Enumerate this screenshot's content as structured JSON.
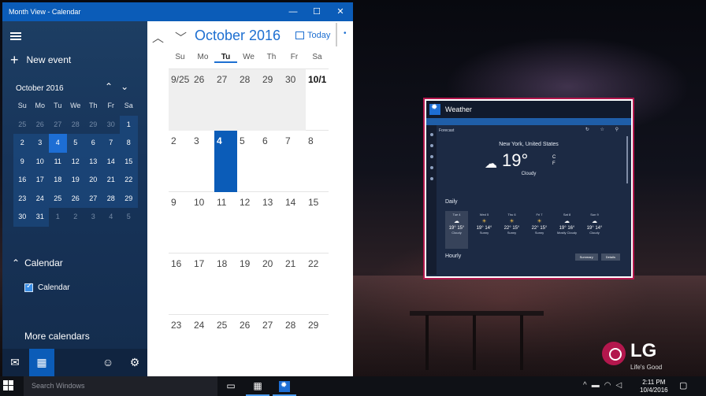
{
  "window": {
    "title": "Month View - Calendar",
    "min_glyph": "—",
    "max_glyph": "☐",
    "close_glyph": "✕"
  },
  "sidebar": {
    "new_event": "New event",
    "mini_month": "October 2016",
    "mini_up": "⌃",
    "mini_down": "⌄",
    "mini_dow": [
      "Su",
      "Mo",
      "Tu",
      "We",
      "Th",
      "Fr",
      "Sa"
    ],
    "mini_weeks": [
      [
        "25",
        "26",
        "27",
        "28",
        "29",
        "30",
        "1"
      ],
      [
        "2",
        "3",
        "4",
        "5",
        "6",
        "7",
        "8"
      ],
      [
        "9",
        "10",
        "11",
        "12",
        "13",
        "14",
        "15"
      ],
      [
        "16",
        "17",
        "18",
        "19",
        "20",
        "21",
        "22"
      ],
      [
        "23",
        "24",
        "25",
        "26",
        "27",
        "28",
        "29"
      ],
      [
        "30",
        "31",
        "1",
        "2",
        "3",
        "4",
        "5"
      ]
    ],
    "calendar_section": "Calendar",
    "calendar_item": "Calendar",
    "more_calendars": "More calendars"
  },
  "main": {
    "month_title": "October 2016",
    "today_label": "Today",
    "dow": [
      "Su",
      "Mo",
      "Tu",
      "We",
      "Th",
      "Fr",
      "Sa"
    ],
    "weeks": [
      [
        "9/25",
        "26",
        "27",
        "28",
        "29",
        "30",
        "10/1"
      ],
      [
        "2",
        "3",
        "4",
        "5",
        "6",
        "7",
        "8"
      ],
      [
        "9",
        "10",
        "11",
        "12",
        "13",
        "14",
        "15"
      ],
      [
        "16",
        "17",
        "18",
        "19",
        "20",
        "21",
        "22"
      ],
      [
        "23",
        "24",
        "25",
        "26",
        "27",
        "28",
        "29"
      ]
    ],
    "selected_day": "4"
  },
  "weather": {
    "title": "Weather",
    "header": "Forecast",
    "city": "New York, United States",
    "temp": "19°",
    "units": "C\nF",
    "condition": "Cloudy",
    "daily_label": "Daily",
    "days": [
      {
        "name": "Tue 4",
        "temp": "19° 15°",
        "cond": "Cloudy"
      },
      {
        "name": "Wed 5",
        "temp": "19° 14°",
        "cond": "Sunny"
      },
      {
        "name": "Thu 6",
        "temp": "22° 15°",
        "cond": "Sunny"
      },
      {
        "name": "Fri 7",
        "temp": "22° 15°",
        "cond": "Sunny"
      },
      {
        "name": "Sat 8",
        "temp": "19° 16°",
        "cond": "Mostly Cloudy"
      },
      {
        "name": "Sun 9",
        "temp": "19° 14°",
        "cond": "Cloudy"
      }
    ],
    "hourly_label": "Hourly",
    "summary_btn": "Summary",
    "details_btn": "Details"
  },
  "taskbar": {
    "search_placeholder": "Search Windows",
    "time": "2:11 PM",
    "date": "10/4/2016"
  },
  "logo": {
    "text": "LG",
    "tagline": "Life's Good"
  },
  "colors": {
    "accent": "#0b5cb8",
    "today": "#1d6ed4",
    "highlight_border": "#b3174d"
  }
}
